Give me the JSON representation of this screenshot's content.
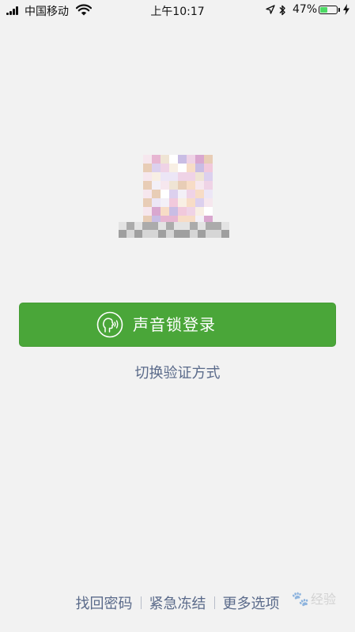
{
  "status_bar": {
    "carrier": "中国移动",
    "time": "上午10:17",
    "battery_pct": "47%",
    "battery_level": 0.47,
    "icons": [
      "signal-icon",
      "wifi-icon",
      "location-icon",
      "bluetooth-icon",
      "battery-icon",
      "charging-icon"
    ]
  },
  "profile": {
    "avatar_icon": "pixelated-avatar",
    "username_icon": "pixelated-username"
  },
  "login": {
    "voice_login_label": "声音锁登录",
    "voice_icon": "voice-lock-icon",
    "button_color": "#4aa639",
    "switch_label": "切换验证方式"
  },
  "bottom_links": {
    "forgot_password": "找回密码",
    "emergency_freeze": "紧急冻结",
    "more_options": "更多选项"
  },
  "watermark": {
    "text": "经验"
  }
}
